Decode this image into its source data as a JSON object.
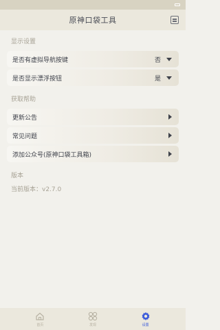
{
  "app": {
    "title": "原神口袋工具"
  },
  "status_bar": {
    "time": "",
    "right": ""
  },
  "sections": {
    "display": {
      "title": "显示设置"
    },
    "help": {
      "title": "获取帮助"
    },
    "version": {
      "title": "版本",
      "current": "当前版本：v2.7.0"
    }
  },
  "display_items": [
    {
      "label": "是否有虚拟导航按键",
      "value": "否"
    },
    {
      "label": "是否显示漂浮按钮",
      "value": "是"
    }
  ],
  "help_items": [
    {
      "label": "更新公告"
    },
    {
      "label": "常见问题"
    },
    {
      "label": "添加公众号(原神口袋工具箱)"
    }
  ],
  "nav": {
    "items": [
      {
        "label": "首页",
        "icon": "home-icon"
      },
      {
        "label": "发现",
        "icon": "grid-icon"
      },
      {
        "label": "设置",
        "icon": "gear-icon",
        "active": true
      }
    ]
  },
  "colors": {
    "active": "#3b5bdb",
    "inactive": "#b7b2a3",
    "background": "#f2f1ec"
  }
}
